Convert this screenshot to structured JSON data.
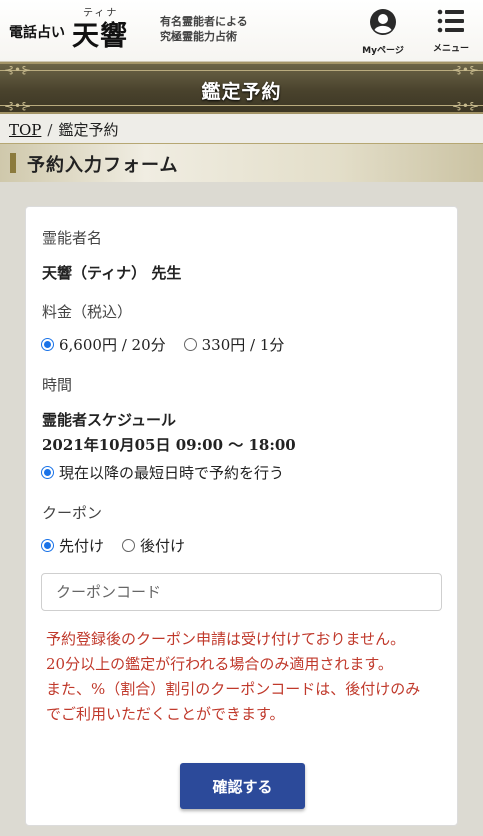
{
  "header": {
    "logo_prefix": "電話占い",
    "logo_name": "天響",
    "logo_ruby": "ティナ",
    "tagline_line1": "有名霊能者による",
    "tagline_line2": "究極霊能力占術",
    "mypage_label": "Myページ",
    "menu_label": "メニュー"
  },
  "page_title": "鑑定予約",
  "breadcrumb": {
    "home": "TOP",
    "separator": "/",
    "current": "鑑定予約"
  },
  "section_title": "予約入力フォーム",
  "form": {
    "reader_label": "霊能者名",
    "reader_value": "天響（ティナ） 先生",
    "fee_label": "料金（税込）",
    "fee_options": [
      {
        "label": "6,600円 / 20分",
        "selected": true
      },
      {
        "label": "330円 / 1分",
        "selected": false
      }
    ],
    "time_label": "時間",
    "schedule_title": "霊能者スケジュール",
    "schedule_value": "2021年10月05日 09:00 〜 18:00",
    "time_option": {
      "label": "現在以降の最短日時で予約を行う",
      "selected": true
    },
    "coupon_label": "クーポン",
    "coupon_options": [
      {
        "label": "先付け",
        "selected": true
      },
      {
        "label": "後付け",
        "selected": false
      }
    ],
    "coupon_placeholder": "クーポンコード",
    "coupon_value": "",
    "notice_lines": [
      "予約登録後のクーポン申請は受け付けておりません。",
      "20分以上の鑑定が行われる場合のみ適用されます。",
      "また、%（割合）割引のクーポンコードは、後付けのみでご利用いただくことができます。"
    ],
    "confirm_label": "確認する"
  },
  "colors": {
    "accent": "#2c4a9a",
    "radio": "#1a73e8",
    "notice": "#c0392b",
    "band": "#4a432d"
  },
  "icons": {
    "mypage": "user-circle-icon",
    "menu": "hamburger-menu-icon"
  }
}
